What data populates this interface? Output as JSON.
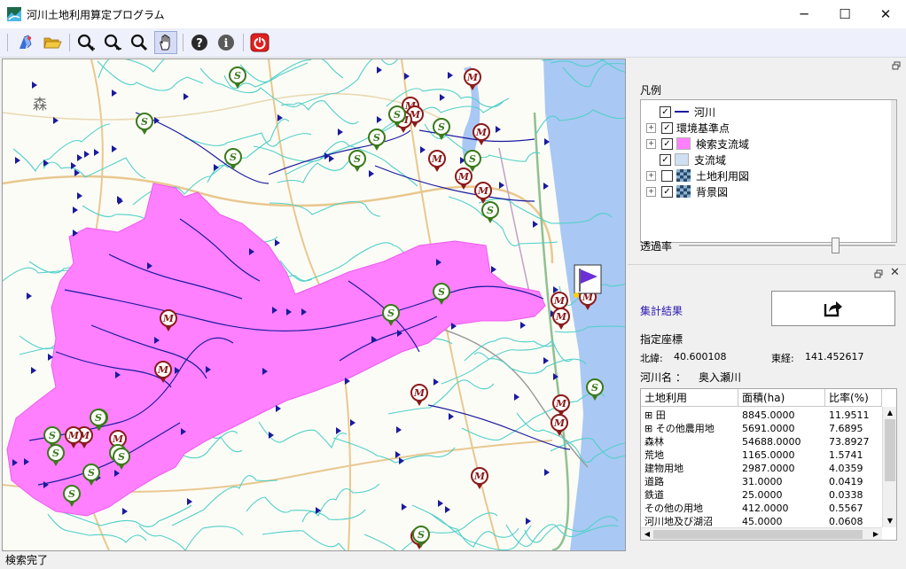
{
  "window": {
    "title": "河川土地利用算定プログラム",
    "minimize_glyph": "─",
    "maximize_glyph": "☐",
    "close_glyph": "✕"
  },
  "toolbar": {
    "buttons": [
      "open-layer-icon",
      "open-folder-icon",
      "zoom-in-icon",
      "zoom-out-icon",
      "zoom-full-icon",
      "pan-hand-icon",
      "help-icon",
      "info-icon",
      "exit-icon"
    ],
    "active": "pan-hand-icon",
    "exit_color": "#e02020"
  },
  "map": {
    "place_label": "森",
    "flag_color": "#6a2fd6",
    "catchment_color": "#ff80ff",
    "river_color": "#1a1aa0",
    "marker_m_color": "#8b1a1a",
    "marker_s_color": "#3a7a1a",
    "marker_m_letter": "M",
    "marker_s_letter": "S"
  },
  "legend": {
    "heading": "凡例",
    "items": [
      {
        "label": "河川",
        "checked": true,
        "expander": false,
        "swatch": "line"
      },
      {
        "label": "環境基準点",
        "checked": true,
        "expander": true,
        "swatch": "none"
      },
      {
        "label": "検索支流域",
        "checked": true,
        "expander": true,
        "swatch": "#ff80ff"
      },
      {
        "label": "支流域",
        "checked": true,
        "expander": false,
        "swatch": "#cfe0f2"
      },
      {
        "label": "土地利用図",
        "checked": false,
        "expander": true,
        "swatch": "mosaic"
      },
      {
        "label": "背景図",
        "checked": true,
        "expander": true,
        "swatch": "mosaic"
      }
    ],
    "opacity_label": "透過率",
    "opacity_value": 0.72
  },
  "results": {
    "heading": "集計結果",
    "export_icon": "export-icon",
    "coord_heading": "指定座標",
    "lat_label": "北緯:",
    "lat_value": "40.600108",
    "lon_label": "東経:",
    "lon_value": "141.452617",
    "river_label": "河川名 ：",
    "river_value": "奥入瀬川",
    "columns": [
      "土地利用",
      "面積(ha)",
      "比率(%)"
    ],
    "rows": [
      {
        "name": "田",
        "area": "8845.0000",
        "ratio": "11.9511",
        "expander": true
      },
      {
        "name": "その他農用地",
        "area": "5691.0000",
        "ratio": "7.6895",
        "expander": true
      },
      {
        "name": "森林",
        "area": "54688.0000",
        "ratio": "73.8927",
        "expander": false
      },
      {
        "name": "荒地",
        "area": "1165.0000",
        "ratio": "1.5741",
        "expander": false
      },
      {
        "name": "建物用地",
        "area": "2987.0000",
        "ratio": "4.0359",
        "expander": false
      },
      {
        "name": "道路",
        "area": "31.0000",
        "ratio": "0.0419",
        "expander": false
      },
      {
        "name": "鉄道",
        "area": "25.0000",
        "ratio": "0.0338",
        "expander": false
      },
      {
        "name": "その他の用地",
        "area": "412.0000",
        "ratio": "0.5567",
        "expander": false
      },
      {
        "name": "河川地及び湖沼",
        "area": "45.0000",
        "ratio": "0.0608",
        "expander": false
      }
    ]
  },
  "status": {
    "text": "検索完了"
  }
}
